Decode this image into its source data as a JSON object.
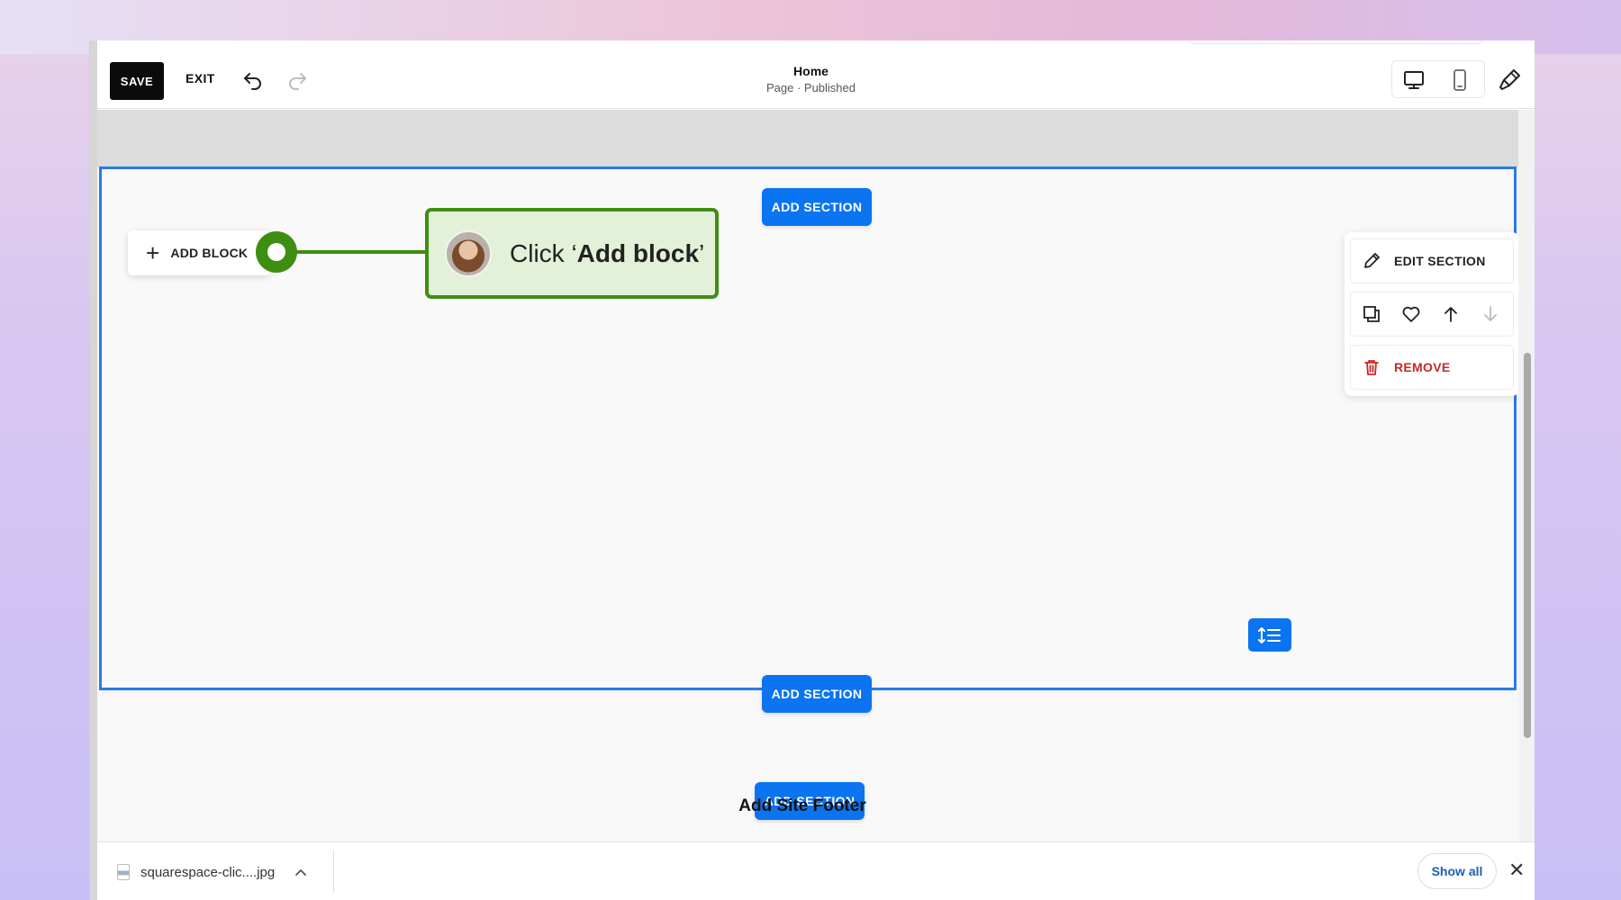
{
  "toolbar": {
    "save_label": "SAVE",
    "exit_label": "EXIT",
    "page_title": "Home",
    "page_status": "Page · Published",
    "icons": [
      "undo-icon",
      "redo-icon",
      "desktop-icon",
      "mobile-icon",
      "paint-brush-icon"
    ]
  },
  "canvas": {
    "add_section_label": "ADD SECTION",
    "add_block_label": "ADD BLOCK",
    "footer_label": "Add Site Footer"
  },
  "tooltip": {
    "prefix": "Click ‘",
    "bold": "Add block",
    "suffix": "’",
    "accent_color": "#3e8e12",
    "background_color": "#e3f1d9"
  },
  "section_menu": {
    "edit_label": "EDIT SECTION",
    "remove_label": "REMOVE",
    "icons": [
      "duplicate-icon",
      "heart-icon",
      "arrow-up-icon",
      "arrow-down-icon"
    ]
  },
  "download_bar": {
    "file_name": "squarespace-clic....jpg",
    "show_all_label": "Show all",
    "close_glyph": "✕"
  },
  "colors": {
    "accent_blue": "#0b74f0",
    "remove_red": "#c62828",
    "save_black": "#0b0b0b"
  }
}
